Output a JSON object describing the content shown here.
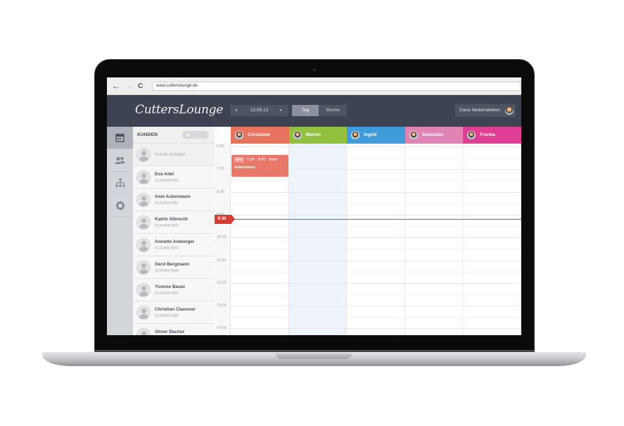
{
  "browser": {
    "url": "www.cutterslounge.de",
    "back_icon": "←",
    "forward_icon": "→",
    "reload_icon": "C"
  },
  "header": {
    "logo": "CuttersLounge",
    "date": "12.05.13",
    "prev_icon": "◂",
    "next_icon": "▸",
    "view_day": "Tag",
    "view_week": "Woche",
    "user_name": "Dana Nedamaldeen"
  },
  "sidebar": {
    "icons": [
      "calendar-icon",
      "users-icon",
      "hierarchy-icon",
      "gear-icon"
    ]
  },
  "customers": {
    "title": "KUNDEN",
    "search_icon": "search-icon",
    "add_label": "Kunde anlegen",
    "items": [
      {
        "name": "Eva Adel",
        "phone": "01234567890"
      },
      {
        "name": "Axel Ackermann",
        "phone": "01234567890"
      },
      {
        "name": "Katrin Albrecht",
        "phone": "01234567890"
      },
      {
        "name": "Annette Amberger",
        "phone": "01234567890"
      },
      {
        "name": "Gerd Bergmann",
        "phone": "01234567890"
      },
      {
        "name": "Yvonne Bauer",
        "phone": "01234567890"
      },
      {
        "name": "Christian Clausner",
        "phone": "01234567890"
      },
      {
        "name": "Oliver Dacher",
        "phone": ""
      }
    ]
  },
  "calendar": {
    "staff": [
      {
        "name": "Christiane",
        "color": "#e8745f"
      },
      {
        "name": "Marion",
        "color": "#92c13f"
      },
      {
        "name": "Ingrid",
        "color": "#3f9bd9"
      },
      {
        "name": "Sebastian",
        "color": "#e084b4"
      },
      {
        "name": "Franka",
        "color": "#de3e93"
      }
    ],
    "times": [
      "6:00",
      "7:00",
      "8:00",
      "9:00",
      "10:00",
      "11:00",
      "12:00",
      "13:00",
      "14:00"
    ],
    "now": "9:30",
    "event": {
      "badge": "WW",
      "time": "6:30 - 8:00",
      "name_first": "Axel",
      "name_last": "Ackermann"
    }
  }
}
